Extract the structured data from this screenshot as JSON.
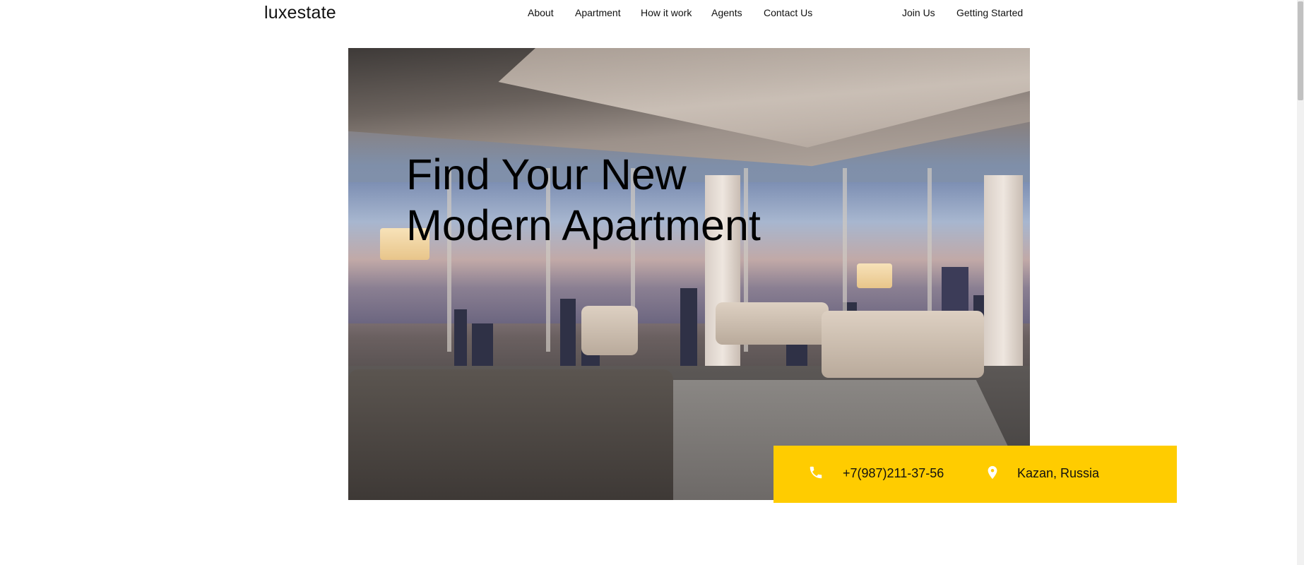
{
  "header": {
    "logo": "luxestate",
    "nav": [
      "About",
      "Apartment",
      "How it work",
      "Agents",
      "Contact Us"
    ],
    "auth": [
      "Join Us",
      "Getting Started"
    ]
  },
  "hero": {
    "title_line1": "Find Your New",
    "title_line2": "Modern Apartment"
  },
  "contact": {
    "phone": "+7(987)211-37-56",
    "location": "Kazan, Russia",
    "phone_icon": "phone-icon",
    "location_icon": "map-pin-icon"
  },
  "colors": {
    "accent": "#ffcc00",
    "text": "#111111",
    "background": "#ffffff"
  }
}
